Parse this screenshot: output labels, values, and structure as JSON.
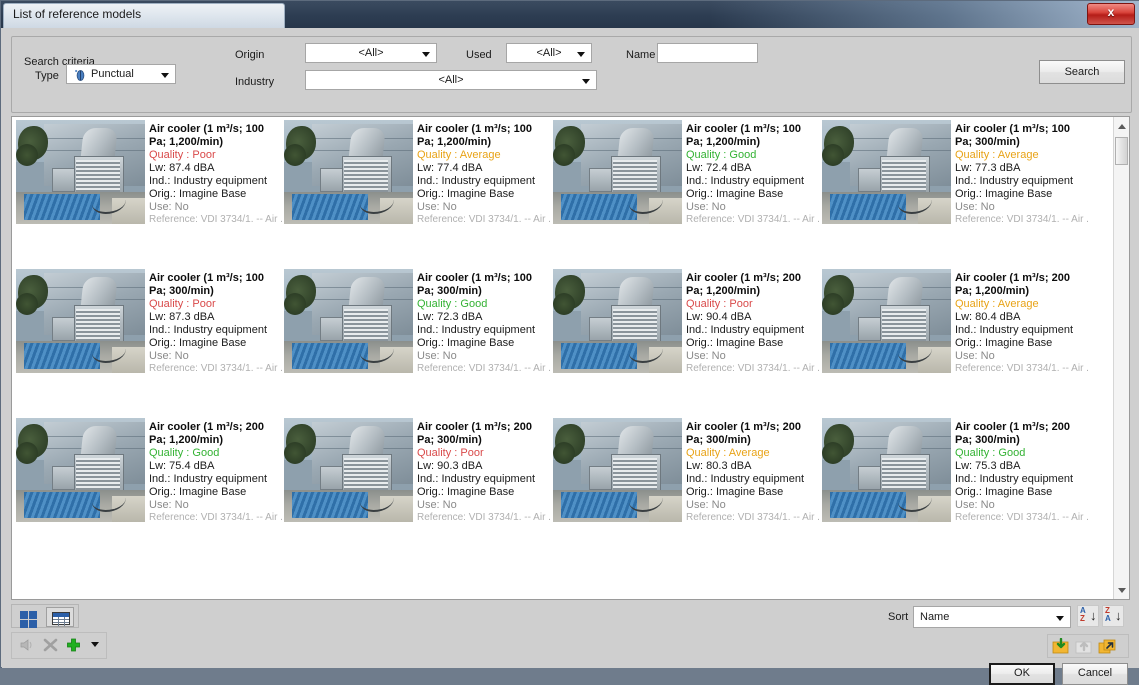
{
  "window": {
    "title": "List of reference models",
    "close_label": "x"
  },
  "search": {
    "group_title": "Search criteria",
    "type_label": "Type",
    "type_value": "Punctual",
    "origin_label": "Origin",
    "origin_value": "<All>",
    "industry_label": "Industry",
    "industry_value": "<All>",
    "used_label": "Used",
    "used_value": "<All>",
    "name_label": "Name",
    "name_value": "",
    "name_placeholder": "",
    "search_button": "Search"
  },
  "colors": {
    "quality_poor": "#d94a4a",
    "quality_average": "#e8a317",
    "quality_good": "#33b233",
    "accent_blue": "#2b5fa8",
    "title_bar": "#2d3d52"
  },
  "cards": [
    {
      "title": "Air cooler (1 m³/s; 100 Pa; 1,200/min)",
      "quality_label": "Quality :",
      "quality": "Poor",
      "quality_color": "#d94a4a",
      "lw": "Lw: 87.4 dBA",
      "industry": "Ind.: Industry equipment",
      "origin": "Orig.: Imagine Base",
      "use": "Use: No",
      "reference": "Reference: VDI 3734/1. -- Air ..."
    },
    {
      "title": "Air cooler (1 m³/s; 100 Pa; 1,200/min)",
      "quality_label": "Quality :",
      "quality": "Average",
      "quality_color": "#e8a317",
      "lw": "Lw: 77.4 dBA",
      "industry": "Ind.: Industry equipment",
      "origin": "Orig.: Imagine Base",
      "use": "Use: No",
      "reference": "Reference: VDI 3734/1. -- Air ..."
    },
    {
      "title": "Air cooler (1 m³/s; 100 Pa; 1,200/min)",
      "quality_label": "Quality :",
      "quality": "Good",
      "quality_color": "#33b233",
      "lw": "Lw: 72.4 dBA",
      "industry": "Ind.: Industry equipment",
      "origin": "Orig.: Imagine Base",
      "use": "Use: No",
      "reference": "Reference: VDI 3734/1. -- Air ..."
    },
    {
      "title": "Air cooler (1 m³/s; 100 Pa; 300/min)",
      "quality_label": "Quality :",
      "quality": "Average",
      "quality_color": "#e8a317",
      "lw": "Lw: 77.3 dBA",
      "industry": "Ind.: Industry equipment",
      "origin": "Orig.: Imagine Base",
      "use": "Use: No",
      "reference": "Reference: VDI 3734/1. -- Air ..."
    },
    {
      "title": "Air cooler (1 m³/s; 100 Pa; 300/min)",
      "quality_label": "Quality :",
      "quality": "Poor",
      "quality_color": "#d94a4a",
      "lw": "Lw: 87.3 dBA",
      "industry": "Ind.: Industry equipment",
      "origin": "Orig.: Imagine Base",
      "use": "Use: No",
      "reference": "Reference: VDI 3734/1. -- Air ..."
    },
    {
      "title": "Air cooler (1 m³/s; 100 Pa; 300/min)",
      "quality_label": "Quality :",
      "quality": "Good",
      "quality_color": "#33b233",
      "lw": "Lw: 72.3 dBA",
      "industry": "Ind.: Industry equipment",
      "origin": "Orig.: Imagine Base",
      "use": "Use: No",
      "reference": "Reference: VDI 3734/1. -- Air ..."
    },
    {
      "title": "Air cooler (1 m³/s; 200 Pa; 1,200/min)",
      "quality_label": "Quality :",
      "quality": "Poor",
      "quality_color": "#d94a4a",
      "lw": "Lw: 90.4 dBA",
      "industry": "Ind.: Industry equipment",
      "origin": "Orig.: Imagine Base",
      "use": "Use: No",
      "reference": "Reference: VDI 3734/1. -- Air ..."
    },
    {
      "title": "Air cooler (1 m³/s; 200 Pa; 1,200/min)",
      "quality_label": "Quality :",
      "quality": "Average",
      "quality_color": "#e8a317",
      "lw": "Lw: 80.4 dBA",
      "industry": "Ind.: Industry equipment",
      "origin": "Orig.: Imagine Base",
      "use": "Use: No",
      "reference": "Reference: VDI 3734/1. -- Air ..."
    },
    {
      "title": "Air cooler (1 m³/s; 200 Pa; 1,200/min)",
      "quality_label": "Quality :",
      "quality": "Good",
      "quality_color": "#33b233",
      "lw": "Lw: 75.4 dBA",
      "industry": "Ind.: Industry equipment",
      "origin": "Orig.: Imagine Base",
      "use": "Use: No",
      "reference": "Reference: VDI 3734/1. -- Air ..."
    },
    {
      "title": "Air cooler (1 m³/s; 200 Pa; 300/min)",
      "quality_label": "Quality :",
      "quality": "Poor",
      "quality_color": "#d94a4a",
      "lw": "Lw: 90.3 dBA",
      "industry": "Ind.: Industry equipment",
      "origin": "Orig.: Imagine Base",
      "use": "Use: No",
      "reference": "Reference: VDI 3734/1. -- Air ..."
    },
    {
      "title": "Air cooler (1 m³/s; 200 Pa; 300/min)",
      "quality_label": "Quality :",
      "quality": "Average",
      "quality_color": "#e8a317",
      "lw": "Lw: 80.3 dBA",
      "industry": "Ind.: Industry equipment",
      "origin": "Orig.: Imagine Base",
      "use": "Use: No",
      "reference": "Reference: VDI 3734/1. -- Air ..."
    },
    {
      "title": "Air cooler (1 m³/s; 200 Pa; 300/min)",
      "quality_label": "Quality :",
      "quality": "Good",
      "quality_color": "#33b233",
      "lw": "Lw: 75.3 dBA",
      "industry": "Ind.: Industry equipment",
      "origin": "Orig.: Imagine Base",
      "use": "Use: No",
      "reference": "Reference: VDI 3734/1. -- Air ..."
    }
  ],
  "bottom": {
    "sort_label": "Sort",
    "sort_value": "Name",
    "sort_asc": "A\nZ",
    "sort_desc": "Z\nA",
    "ok_label": "OK",
    "cancel_label": "Cancel"
  }
}
